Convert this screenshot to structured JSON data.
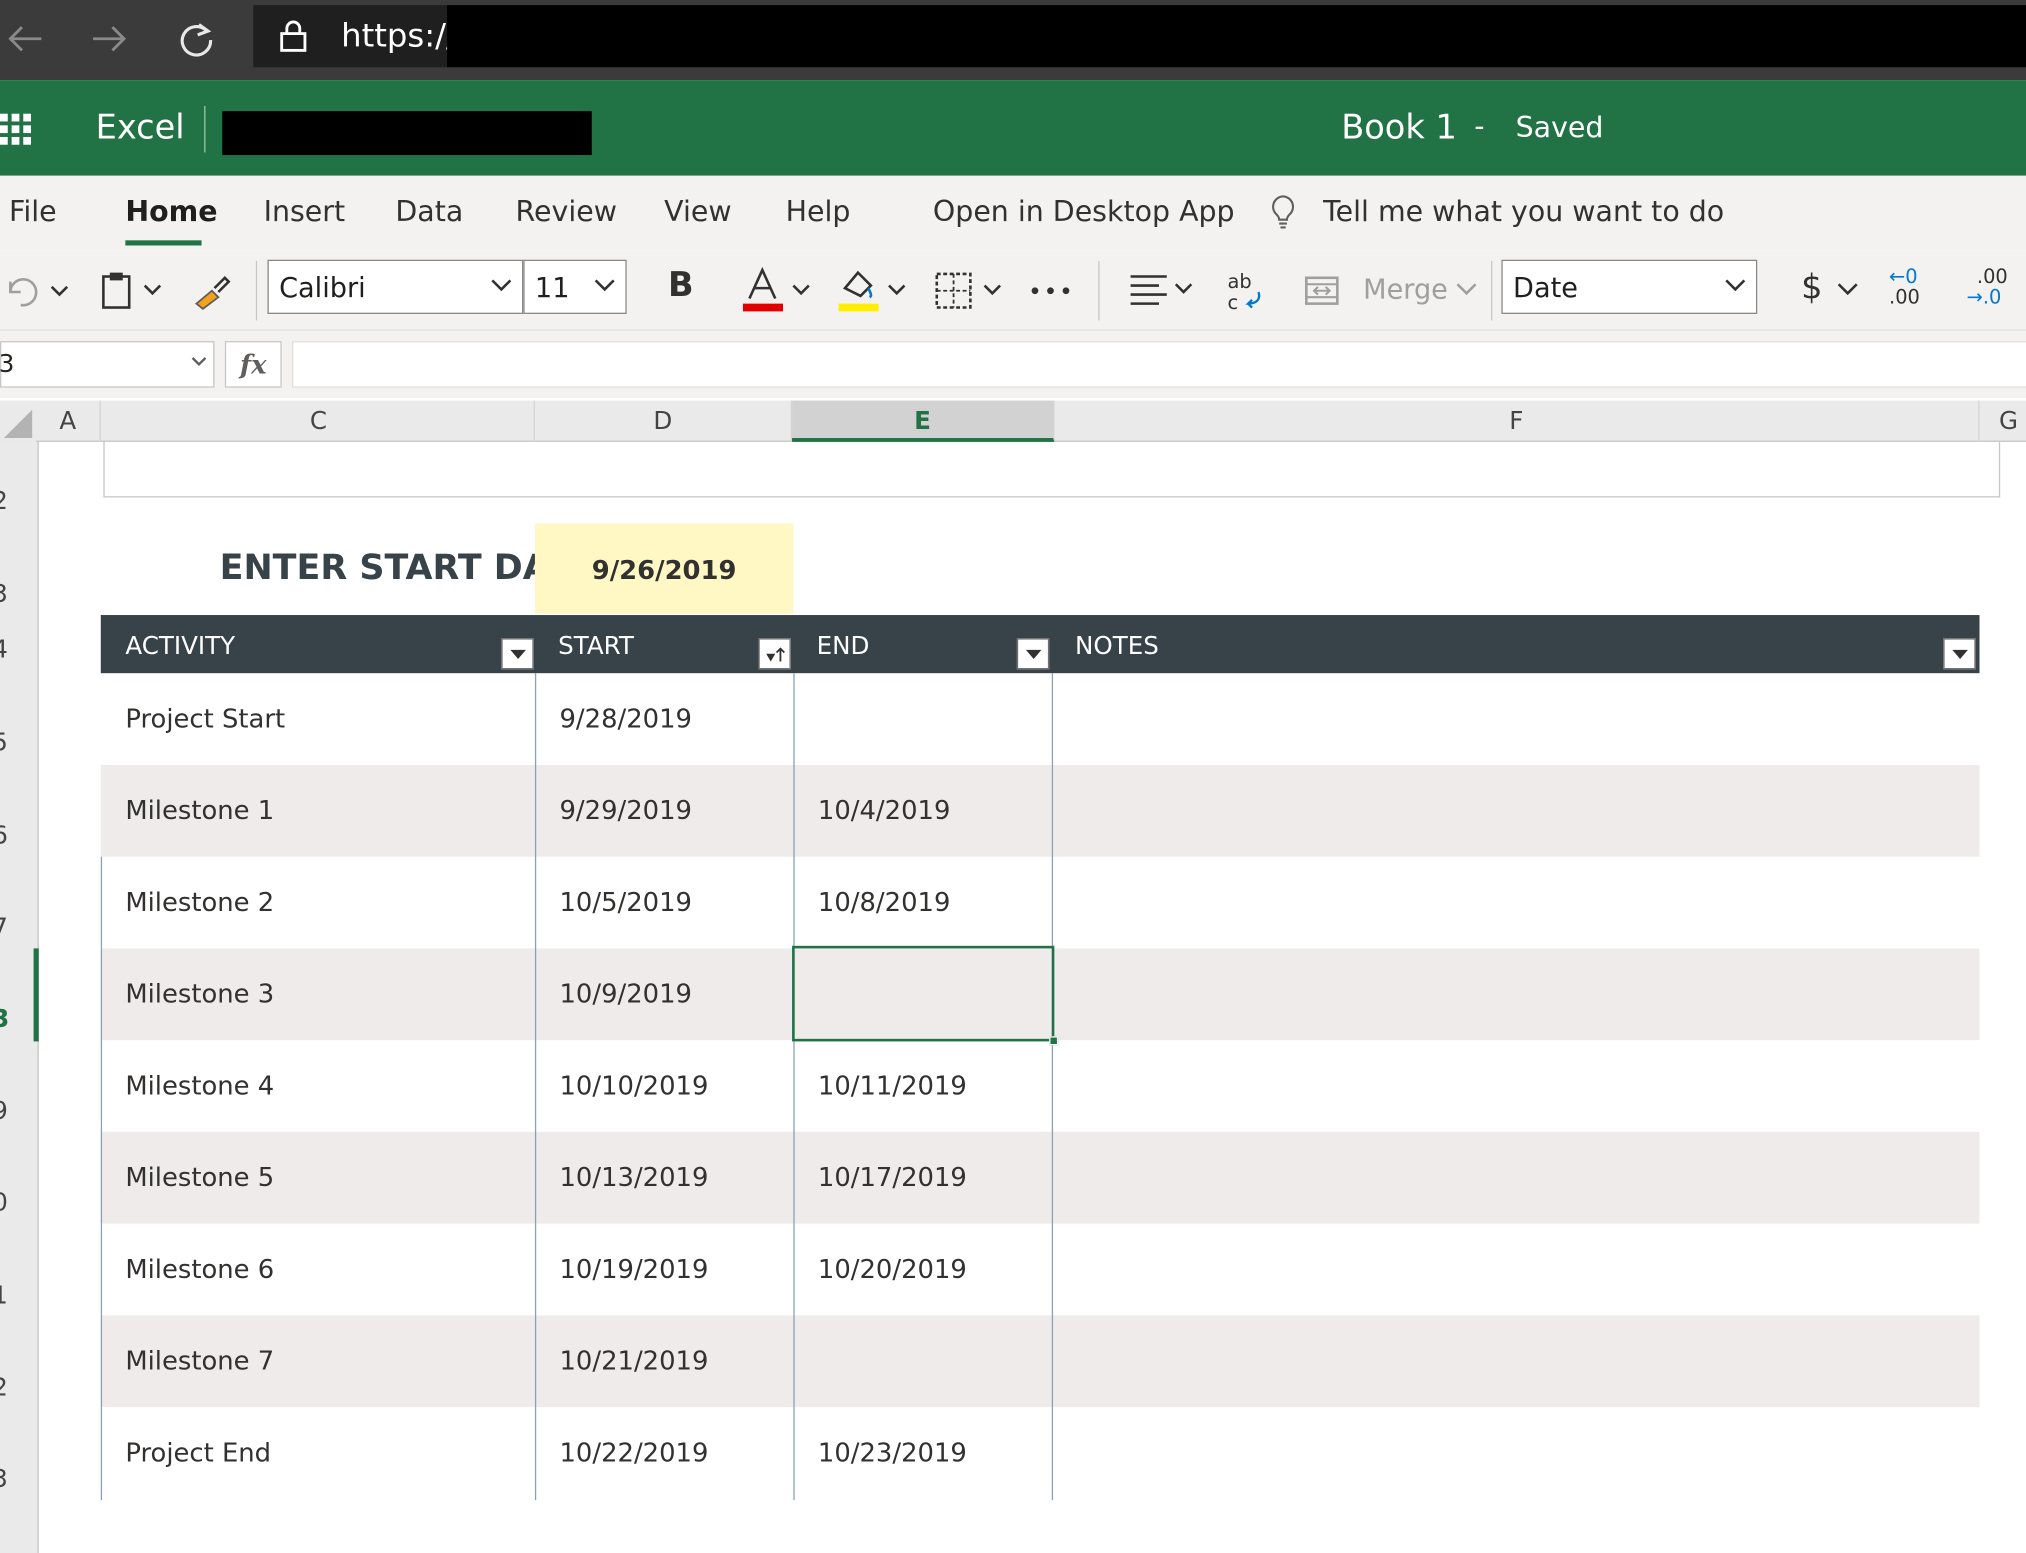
{
  "browser": {
    "protocol": "https://"
  },
  "app": {
    "name": "Excel",
    "book_title": "Book 1",
    "separator": "-",
    "save_status": "Saved"
  },
  "ribbon": {
    "tabs": [
      "File",
      "Home",
      "Insert",
      "Data",
      "Review",
      "View",
      "Help",
      "Open in Desktop App"
    ],
    "active_tab": "Home",
    "tell_me": "Tell me what you want to do"
  },
  "toolbar": {
    "font_name": "Calibri",
    "font_size": "11",
    "bold_label": "B",
    "merge_label": "Merge",
    "number_format": "Date",
    "currency_symbol": "$",
    "decrease_decimal_top": "←0",
    "decrease_decimal_bottom": ".00",
    "increase_decimal_top": ".00",
    "increase_decimal_bottom": "→.0",
    "font_color": "#e00000",
    "highlight_color": "#ffee00"
  },
  "formula_bar": {
    "name_box": "3",
    "fx_label": "fx",
    "formula": ""
  },
  "grid": {
    "columns": [
      "A",
      "C",
      "D",
      "E",
      "F",
      "G"
    ],
    "selected_column": "E",
    "rows": [
      "2",
      "3",
      "4",
      "5",
      "6",
      "7",
      "3",
      "9",
      "0",
      "1",
      "2",
      "3"
    ],
    "selected_row_index": 6
  },
  "sheet": {
    "start_label": "ENTER START DATE:",
    "start_date": "9/26/2019",
    "table": {
      "headers": [
        "ACTIVITY",
        "START",
        "END",
        "NOTES"
      ],
      "rows": [
        {
          "activity": "Project Start",
          "start": "9/28/2019",
          "end": "",
          "notes": ""
        },
        {
          "activity": "Milestone 1",
          "start": "9/29/2019",
          "end": "10/4/2019",
          "notes": ""
        },
        {
          "activity": "Milestone 2",
          "start": "10/5/2019",
          "end": "10/8/2019",
          "notes": ""
        },
        {
          "activity": "Milestone 3",
          "start": "10/9/2019",
          "end": "",
          "notes": ""
        },
        {
          "activity": "Milestone 4",
          "start": "10/10/2019",
          "end": "10/11/2019",
          "notes": ""
        },
        {
          "activity": "Milestone 5",
          "start": "10/13/2019",
          "end": "10/17/2019",
          "notes": ""
        },
        {
          "activity": "Milestone 6",
          "start": "10/19/2019",
          "end": "10/20/2019",
          "notes": ""
        },
        {
          "activity": "Milestone 7",
          "start": "10/21/2019",
          "end": "",
          "notes": ""
        },
        {
          "activity": "Project End",
          "start": "10/22/2019",
          "end": "10/23/2019",
          "notes": ""
        }
      ]
    }
  }
}
